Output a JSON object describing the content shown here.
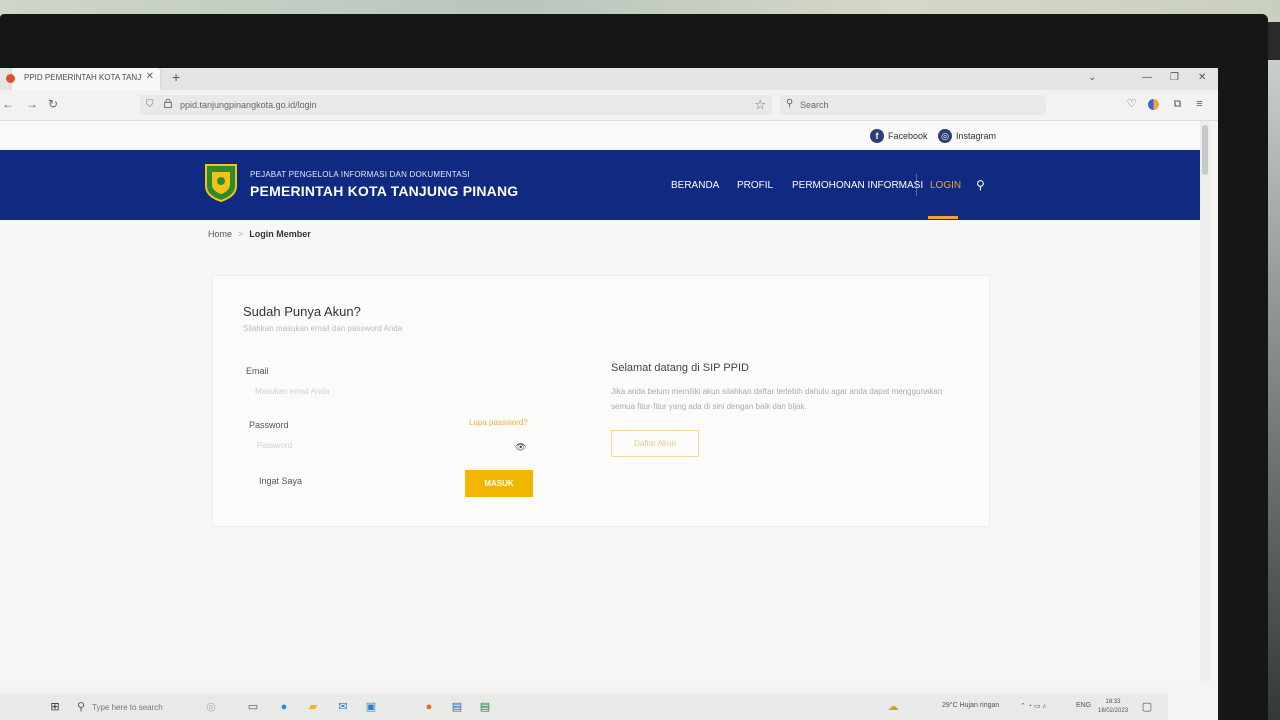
{
  "browser": {
    "tab_title": "PPID PEMERINTAH KOTA TANJUNG P",
    "tab_close": "✕",
    "new_tab": "+",
    "url": "ppid.tanjungpinangkota.go.id/login",
    "search_placeholder": "Search"
  },
  "social": {
    "facebook": "Facebook",
    "instagram": "Instagram"
  },
  "header": {
    "subtitle": "PEJABAT PENGELOLA INFORMASI DAN DOKUMENTASI",
    "title": "PEMERINTAH KOTA TANJUNG PINANG",
    "menu": {
      "beranda": "BERANDA",
      "profil": "PROFIL",
      "permohonan": "PERMOHONAN INFORMASI",
      "login": "LOGIN"
    },
    "accent_color": "#f3a51d",
    "bg_color": "#0f2a80"
  },
  "breadcrumb": {
    "home": "Home",
    "separator": ">",
    "current": "Login Member"
  },
  "login": {
    "title": "Sudah Punya Akun?",
    "subtitle": "Silahkan masukan email dan password Anda",
    "email_label": "Email",
    "email_placeholder": "Masukan email Anda",
    "password_label": "Password",
    "password_placeholder": "Password",
    "forgot": "Lupa password?",
    "remember": "Ingat Saya",
    "submit": "MASUK",
    "button_color": "#f2b600"
  },
  "welcome": {
    "title": "Selamat datang di SIP PPID",
    "text": "Jika anda belum memiliki akun silahkan daftar terlebih dahulu agar anda dapat menggunakan semua fitur-fitur yang ada di sini dengan baik dan bijak.",
    "register": "Daftar Akun"
  },
  "taskbar": {
    "search_placeholder": "Type here to search",
    "weather": "29°C  Hujan ringan",
    "lang": "ENG",
    "time": "18:33",
    "date": "16/02/2023"
  }
}
